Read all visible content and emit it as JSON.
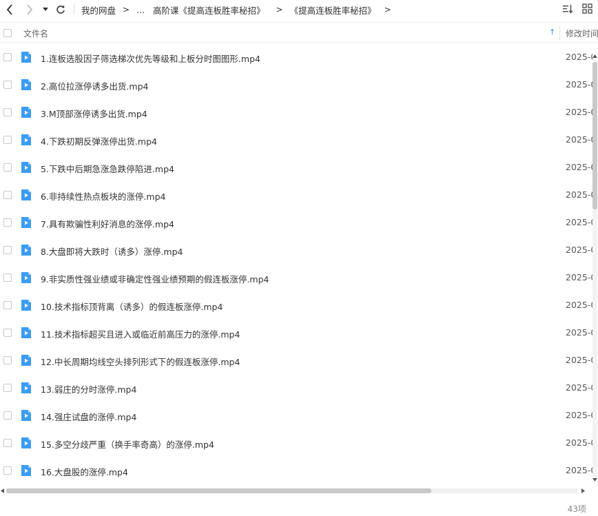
{
  "toolbar": {
    "crumbs": [
      "我的网盘",
      "...",
      "高阶课《提高连板胜率秘招》",
      "《提高连板胜率秘招》"
    ],
    "sep": ">"
  },
  "header": {
    "name_label": "文件名",
    "time_label": "修改时间",
    "sort_arrow": "↑"
  },
  "files": [
    {
      "name": "1.连板选股因子筛选梯次优先等级和上板分时图图形.mp4",
      "date": "2025-0"
    },
    {
      "name": "2.高位拉涨停诱多出货.mp4",
      "date": "2025-0"
    },
    {
      "name": "3.M顶部涨停诱多出货.mp4",
      "date": "2025-0"
    },
    {
      "name": "4.下跌初期反弹涨停出货.mp4",
      "date": "2025-0"
    },
    {
      "name": "5.下跌中后期急涨急跌停陷进.mp4",
      "date": "2025-0"
    },
    {
      "name": "6.非持续性热点板块的涨停.mp4",
      "date": "2025-0"
    },
    {
      "name": "7.具有欺骗性利好消息的涨停.mp4",
      "date": "2025-0"
    },
    {
      "name": "8.大盘即将大跌时（诱多）涨停.mp4",
      "date": "2025-0"
    },
    {
      "name": "9.非实质性强业绩或非确定性强业绩预期的假连板涨停.mp4",
      "date": "2025-0"
    },
    {
      "name": "10.技术指标顶背离（诱多）的假连板涨停.mp4",
      "date": "2025-0"
    },
    {
      "name": "11.技术指标超买且进入或临近前高压力的涨停.mp4",
      "date": "2025-0"
    },
    {
      "name": "12.中长周期均线空头排列形式下的假连板涨停.mp4",
      "date": "2025-0"
    },
    {
      "name": "13.弱庄的分时涨停.mp4",
      "date": "2025-0"
    },
    {
      "name": "14.强庄试盘的涨停.mp4",
      "date": "2025-0"
    },
    {
      "name": "15.多空分歧严重（换手率奇高）的涨停.mp4",
      "date": "2025-0"
    },
    {
      "name": "16.大盘股的涨停.mp4",
      "date": "2025-0"
    }
  ],
  "status": {
    "count": "43项"
  },
  "colors": {
    "accent": "#2a8cf5",
    "video_icon": "#3b9cf5"
  }
}
